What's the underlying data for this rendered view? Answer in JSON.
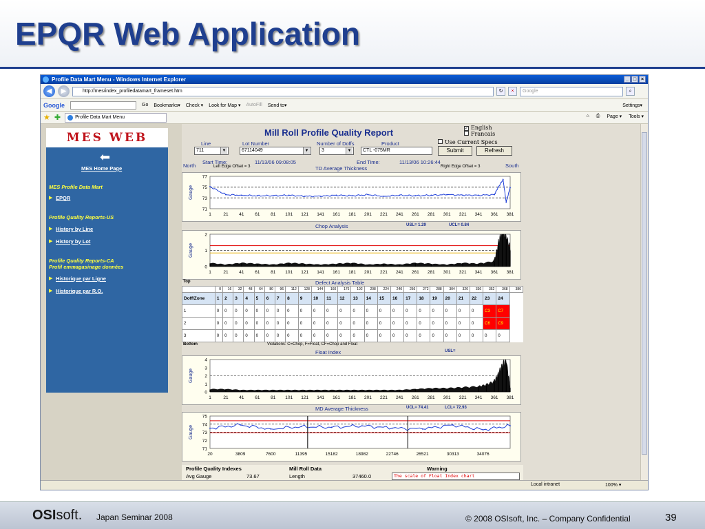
{
  "slide": {
    "title": "EPQR Web Application",
    "footer_brand_bold": "OSI",
    "footer_brand_rest": "soft.",
    "footer_seminar": "Japan Seminar 2008",
    "footer_copyright": "© 2008 OSIsoft, Inc. – Company Confidential",
    "page_number": "39"
  },
  "browser": {
    "window_title": "Profile Data Mart Menu - Windows Internet Explorer",
    "url": "http://mes/index_profiledatamart_frameset.htm",
    "search_placeholder": "Google",
    "google_label": "Google",
    "google_items": [
      "Go",
      "Bookmarks▾",
      "Check ▾",
      "Look for Map ▾",
      "AutoFill",
      "Send to▾"
    ],
    "settings_label": "Settings▾",
    "tab_label": "Profile Data Mart Menu",
    "tools_items": [
      "Page ▾",
      "Tools ▾"
    ],
    "status_zone": "Local intranet",
    "status_zoom": "100% ▾"
  },
  "leftnav": {
    "logo": "MES WEB",
    "home": "MES Home Page",
    "section1": "MES Profile Data Mart",
    "link_epqr": "EPQR",
    "section2": "Profile Quality Reports-US",
    "link_history_line": "History by Line",
    "link_history_lot": "History by Lot",
    "section3_line1": "Profile Quality Reports-CA",
    "section3_line2": "Profil emmagasinage données",
    "link_historique_ligne": "Historique par Ligne",
    "link_historique_ro": "Historique par R.O."
  },
  "report": {
    "title": "Mill Roll Profile Quality Report",
    "lang_english": "English",
    "lang_francais": "Francais",
    "use_specs": "Use Current Specs",
    "line_label": "Line",
    "line_value": "711",
    "lot_label": "Lot Number",
    "lot_value": "67114049",
    "doffs_label": "Number of Doffs",
    "doffs_value": "3",
    "product_label": "Product",
    "product_value": "CTL      -075MR",
    "submit": "Submit",
    "refresh": "Refresh",
    "north": "North",
    "south": "South",
    "start_label": "Start Time:",
    "start_value": "11/13/06 09:08:05",
    "end_label": "End Time:",
    "end_value": "11/13/06 10:26:44",
    "left_offset": "Left Edge Offset = 3",
    "right_offset": "Right Edge Offset = 3",
    "td_title": "TD Average Thickness",
    "chop_title": "Chop Analysis",
    "chop_usl": "USL=  1.29",
    "chop_ucl": "UCL=  0.84",
    "defect_title": "Defect Analysis Table",
    "top_label": "Top",
    "bottom_label": "Bottom",
    "violations": "Violations: C=Chop, F=Float, CF=Chop and Float",
    "float_title": "Float Index",
    "float_usl": "USL=",
    "md_title": "MD Average Thickness",
    "md_ucl": "UCL=  74.41",
    "md_lcl": "LCL=  72.93",
    "pqi_title": "Profile Quality Indexes",
    "pqi_avg_label": "Avg Gauge",
    "pqi_avg_value": "73.67",
    "mrd_title": "Mill Roll Data",
    "mrd_length_label": "Length",
    "mrd_length_value": "37460.0",
    "warning_title": "Warning",
    "warning_text": "The scale of Float Index chart",
    "gauge_label": "Gauge",
    "x_ticks": [
      "1",
      "21",
      "41",
      "61",
      "81",
      "101",
      "121",
      "141",
      "161",
      "181",
      "201",
      "221",
      "241",
      "261",
      "281",
      "301",
      "321",
      "341",
      "361",
      "381"
    ],
    "md_x_ticks": [
      "20",
      "3809",
      "7600",
      "11395",
      "15182",
      "18982",
      "22746",
      "26521",
      "30313",
      "34076"
    ]
  },
  "defect_table": {
    "positions": [
      "0",
      "16",
      "32",
      "48",
      "64",
      "80",
      "96",
      "112",
      "128",
      "144",
      "160",
      "176",
      "192",
      "208",
      "224",
      "240",
      "256",
      "272",
      "288",
      "304",
      "320",
      "336",
      "352",
      "368",
      "380"
    ],
    "header": [
      "Doff/Zone",
      "1",
      "2",
      "3",
      "4",
      "5",
      "6",
      "7",
      "8",
      "9",
      "10",
      "11",
      "12",
      "13",
      "14",
      "15",
      "16",
      "17",
      "18",
      "19",
      "20",
      "21",
      "22",
      "23",
      "24"
    ],
    "rows": [
      [
        "1",
        "0",
        "0",
        "0",
        "0",
        "0",
        "0",
        "0",
        "0",
        "0",
        "0",
        "0",
        "0",
        "0",
        "0",
        "0",
        "0",
        "0",
        "0",
        "0",
        "0",
        "0",
        "0",
        "C3",
        "C7"
      ],
      [
        "2",
        "0",
        "0",
        "0",
        "0",
        "0",
        "0",
        "0",
        "0",
        "0",
        "0",
        "0",
        "0",
        "0",
        "0",
        "0",
        "0",
        "0",
        "0",
        "0",
        "0",
        "0",
        "0",
        "C6",
        "C9"
      ],
      [
        "3",
        "0",
        "0",
        "0",
        "0",
        "0",
        "0",
        "0",
        "0",
        "0",
        "0",
        "0",
        "0",
        "0",
        "0",
        "0",
        "0",
        "0",
        "0",
        "0",
        "0",
        "0",
        "0",
        "0",
        "0"
      ]
    ]
  },
  "chart_data": [
    {
      "type": "line",
      "title": "TD Average Thickness",
      "ylabel": "Gauge",
      "ylim": [
        71,
        77
      ],
      "yticks": [
        71,
        73,
        75,
        77
      ],
      "x": [
        1,
        21,
        41,
        61,
        81,
        101,
        121,
        141,
        161,
        181,
        201,
        221,
        241,
        261,
        281,
        301,
        321,
        341,
        361,
        366,
        372,
        376,
        381
      ],
      "values": [
        75.1,
        73.6,
        73.5,
        73.4,
        73.4,
        73.5,
        73.3,
        73.3,
        73.5,
        73.4,
        73.6,
        73.3,
        73.5,
        73.4,
        73.5,
        73.6,
        73.5,
        73.5,
        73.6,
        75.0,
        76.4,
        72.2,
        74.9
      ],
      "reference_lines": [
        73,
        75
      ]
    },
    {
      "type": "bar",
      "title": "Chop Analysis",
      "ylabel": "Gauge",
      "ylim": [
        0,
        2
      ],
      "yticks": [
        0,
        1,
        2
      ],
      "x": [
        1,
        21,
        41,
        61,
        81,
        101,
        121,
        141,
        161,
        181,
        201,
        221,
        241,
        261,
        281,
        301,
        321,
        341,
        361,
        366,
        371,
        376,
        381
      ],
      "values": [
        0.2,
        0.1,
        0.2,
        0.15,
        0.1,
        0.2,
        0.15,
        0.1,
        0.15,
        0.2,
        0.1,
        0.15,
        0.1,
        0.2,
        0.15,
        0.1,
        0.2,
        0.15,
        0.3,
        1.3,
        2.0,
        1.7,
        1.0
      ],
      "usl": 1.29,
      "ucl": 0.84
    },
    {
      "type": "bar",
      "title": "Float Index",
      "ylabel": "Gauge",
      "ylim": [
        0,
        4
      ],
      "yticks": [
        0,
        1,
        2,
        3,
        4
      ],
      "x": [
        1,
        21,
        41,
        61,
        81,
        101,
        121,
        141,
        161,
        181,
        201,
        221,
        241,
        261,
        281,
        301,
        321,
        341,
        351,
        361,
        366,
        371,
        376,
        381
      ],
      "values": [
        0.3,
        0.3,
        0.2,
        0.2,
        0.2,
        0.2,
        0.2,
        0.2,
        0.2,
        0.2,
        0.2,
        0.2,
        0.2,
        0.3,
        0.4,
        0.4,
        0.5,
        0.6,
        0.8,
        1.2,
        2.0,
        3.0,
        3.6,
        0.5
      ]
    },
    {
      "type": "line",
      "title": "MD Average Thickness",
      "ylabel": "Gauge",
      "ylim": [
        71,
        75
      ],
      "yticks": [
        71,
        72,
        73,
        74,
        75
      ],
      "x": [
        20,
        3809,
        7600,
        11395,
        15182,
        18982,
        22746,
        26521,
        30313,
        34076,
        37460
      ],
      "values": [
        73.5,
        73.9,
        73.4,
        73.7,
        73.6,
        73.8,
        73.5,
        73.4,
        73.9,
        73.3,
        73.8
      ],
      "ucl": 74.41,
      "lcl": 72.93
    }
  ]
}
